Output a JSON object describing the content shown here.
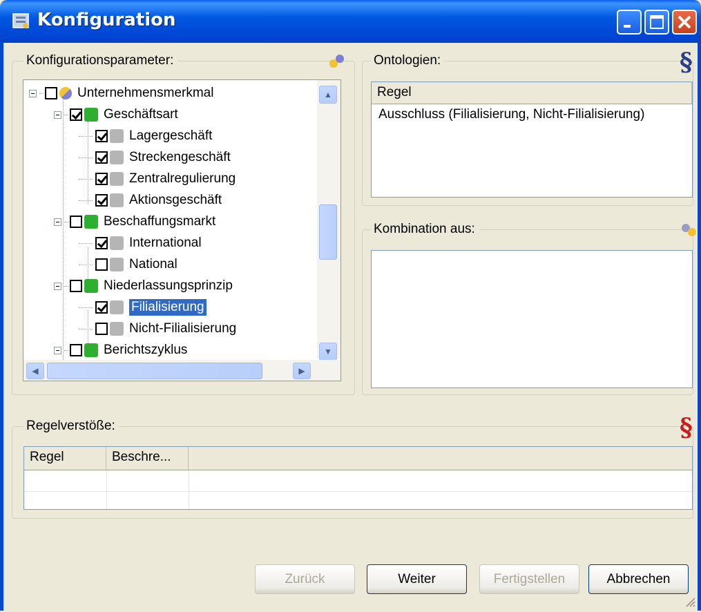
{
  "window": {
    "title": "Konfiguration",
    "icons": {
      "app": "app-icon",
      "minimize": "minimize-icon",
      "maximize": "maximize-icon",
      "close": "close-icon"
    }
  },
  "config_group": {
    "legend": "Konfigurationsparameter:",
    "icon": "gears-icon",
    "tree": [
      {
        "label": "Unternehmensmerkmal",
        "checked": false,
        "icon": "gears-icon",
        "expanded": true,
        "level": 0
      },
      {
        "label": "Geschäftsart",
        "checked": true,
        "icon": "green-puzzle-icon",
        "expanded": true,
        "level": 1
      },
      {
        "label": "Lagergeschäft",
        "checked": true,
        "icon": "grey-puzzle-icon",
        "level": 2
      },
      {
        "label": "Streckengeschäft",
        "checked": true,
        "icon": "grey-puzzle-icon",
        "level": 2
      },
      {
        "label": "Zentralregulierung",
        "checked": true,
        "icon": "grey-puzzle-icon",
        "level": 2
      },
      {
        "label": "Aktionsgeschäft",
        "checked": true,
        "icon": "grey-puzzle-icon",
        "level": 2
      },
      {
        "label": "Beschaffungsmarkt",
        "checked": false,
        "icon": "green-puzzle-icon",
        "expanded": true,
        "level": 1
      },
      {
        "label": "International",
        "checked": true,
        "icon": "grey-puzzle-icon",
        "level": 2
      },
      {
        "label": "National",
        "checked": false,
        "icon": "grey-puzzle-icon",
        "level": 2
      },
      {
        "label": "Niederlassungsprinzip",
        "checked": false,
        "icon": "green-puzzle-icon",
        "expanded": true,
        "level": 1
      },
      {
        "label": "Filialisierung",
        "checked": true,
        "icon": "grey-puzzle-icon",
        "level": 2,
        "selected": true
      },
      {
        "label": "Nicht-Filialisierung",
        "checked": false,
        "icon": "grey-puzzle-icon",
        "level": 2
      },
      {
        "label": "Berichtszyklus",
        "checked": false,
        "icon": "green-puzzle-icon",
        "expanded": true,
        "level": 1
      }
    ]
  },
  "ontologien": {
    "legend": "Ontologien:",
    "icon": "section-sign-icon",
    "column": "Regel",
    "rows": [
      "Ausschluss (Filialisierung, Nicht-Filialisierung)"
    ]
  },
  "kombination": {
    "legend": "Kombination aus:",
    "icon": "gears-icon"
  },
  "regelverstoesse": {
    "legend": "Regelverstöße:",
    "icon": "section-sign-red-icon",
    "columns": [
      "Regel",
      "Beschre..."
    ]
  },
  "buttons": {
    "back": "Zurück",
    "next": "Weiter",
    "finish": "Fertigstellen",
    "cancel": "Abbrechen"
  },
  "colors": {
    "titlebar": "#0047D6",
    "selection": "#316AC5",
    "section_blue": "#2B3F8A",
    "section_red": "#C81E1E"
  }
}
